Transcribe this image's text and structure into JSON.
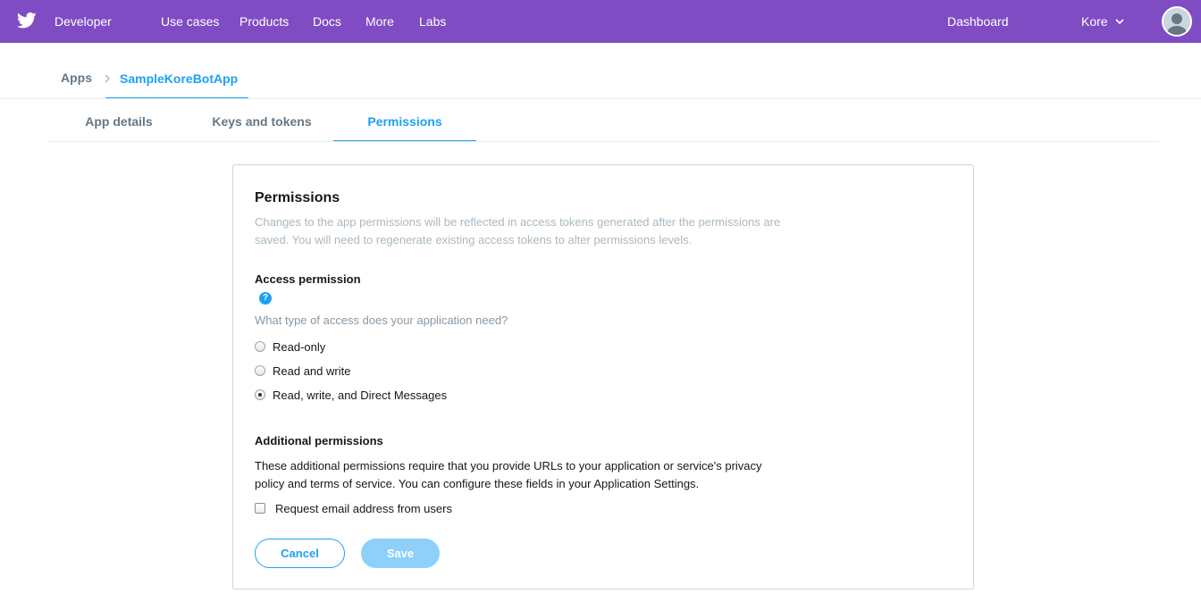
{
  "colors": {
    "header_bg": "#7f4cc3",
    "accent": "#1da1f2",
    "muted": "#aab8c2"
  },
  "topnav": {
    "brand": "Developer",
    "links": [
      "Use cases",
      "Products",
      "Docs",
      "More",
      "Labs"
    ],
    "dashboard": "Dashboard",
    "user": "Kore",
    "logo_icon": "twitter-bird-icon",
    "user_menu_icon": "chevron-down-icon",
    "avatar_icon": "default-avatar-icon"
  },
  "breadcrumb": {
    "root": "Apps",
    "current": "SampleKoreBotApp",
    "separator_icon": "chevron-right-icon"
  },
  "tabs": [
    "App details",
    "Keys and tokens",
    "Permissions"
  ],
  "active_tab": "Permissions",
  "permissions": {
    "title": "Permissions",
    "description": "Changes to the app permissions will be reflected in access tokens generated after the permissions are saved. You will need to regenerate existing access tokens to alter permissions levels.",
    "access": {
      "heading": "Access permission",
      "help_glyph": "?",
      "help_icon": "help-icon",
      "question": "What type of access does your application need?",
      "options": [
        "Read-only",
        "Read and write",
        "Read, write, and Direct Messages"
      ],
      "selected": "Read, write, and Direct Messages"
    },
    "additional": {
      "heading": "Additional permissions",
      "body": "These additional permissions require that you provide URLs to your application or service's privacy policy and terms of service. You can configure these fields in your Application Settings.",
      "checkbox_label": "Request email address from users",
      "checked": false
    },
    "buttons": {
      "cancel": "Cancel",
      "save": "Save"
    }
  }
}
